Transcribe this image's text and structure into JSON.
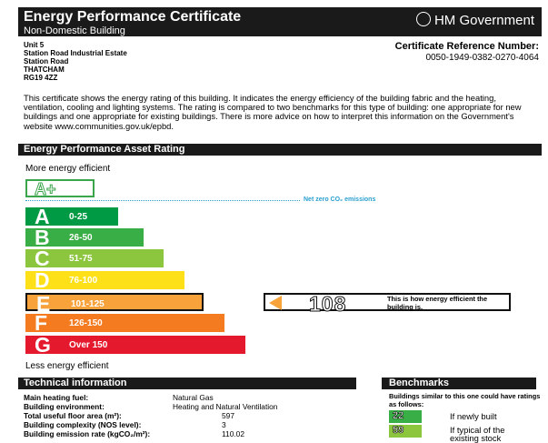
{
  "header": {
    "title": "Energy Performance Certificate",
    "subtitle": "Non-Domestic Building",
    "government": "HM Government"
  },
  "address": [
    "Unit 5",
    "Station Road Industrial Estate",
    "Station Road",
    "THATCHAM",
    "RG19 4ZZ"
  ],
  "certificate": {
    "label": "Certificate Reference Number:",
    "number": "0050-1949-0382-0270-4064"
  },
  "intro": "This certificate shows the energy rating of this building. It indicates the energy efficiency of the building fabric and the heating, ventilation, cooling and lighting systems. The rating is compared to two benchmarks for this type of building: one appropriate for new buildings and one appropriate for existing buildings. There is more advice on how to interpret this information on the Government's website www.communities.gov.uk/epbd.",
  "asset_rating": {
    "title": "Energy Performance Asset Rating",
    "more_efficient": "More energy efficient",
    "less_efficient": "Less energy efficient",
    "aplus_label": "A+",
    "net_zero": "Net zero CO₂ emissions",
    "bands": [
      {
        "letter": "A",
        "range": "0-25",
        "color": "#009a44"
      },
      {
        "letter": "B",
        "range": "26-50",
        "color": "#3aae46"
      },
      {
        "letter": "C",
        "range": "51-75",
        "color": "#8cc63f"
      },
      {
        "letter": "D",
        "range": "76-100",
        "color": "#fde018"
      },
      {
        "letter": "E",
        "range": "101-125",
        "color": "#f7a23a"
      },
      {
        "letter": "F",
        "range": "126-150",
        "color": "#f47b20"
      },
      {
        "letter": "G",
        "range": "Over 150",
        "color": "#e4192e"
      }
    ],
    "selected_band": "E",
    "rating_value": "108",
    "rating_description": "This is how energy efficient the building is."
  },
  "technical": {
    "title": "Technical information",
    "rows": [
      {
        "label": "Main heating fuel:",
        "value": "Natural Gas"
      },
      {
        "label": "Building environment:",
        "value": "Heating and Natural Ventilation"
      },
      {
        "label": "Total useful floor area (m²):",
        "value": "597"
      },
      {
        "label": "Building complexity (NOS level):",
        "value": "3"
      },
      {
        "label": "Building emission rate (kgCO₂/m²):",
        "value": "110.02"
      }
    ]
  },
  "benchmarks": {
    "title": "Benchmarks",
    "note": "Buildings similar to this one could have ratings as follows:",
    "items": [
      {
        "value": "22",
        "text": "If newly built",
        "color": "#3aae46"
      },
      {
        "value": "59",
        "text": "If typical of the existing stock",
        "color": "#8cc63f"
      }
    ]
  }
}
